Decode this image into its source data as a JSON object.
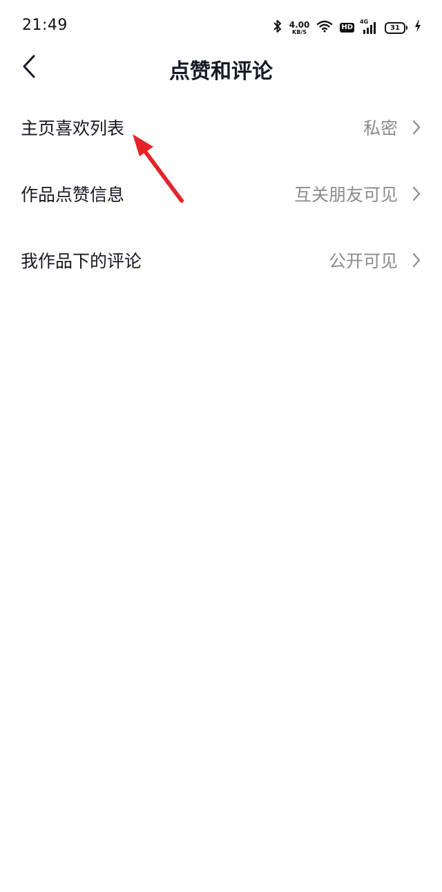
{
  "status_bar": {
    "time": "21:49",
    "net_speed_value": "4.00",
    "net_speed_unit": "KB/S",
    "hd_label": "HD",
    "signal_label": "4G",
    "battery_level": "31",
    "icons": [
      "bluetooth-icon",
      "wifi-icon",
      "hd-icon",
      "signal-icon",
      "battery-icon",
      "charging-icon"
    ]
  },
  "header": {
    "title": "点赞和评论",
    "back_icon": "chevron-left-icon"
  },
  "settings": {
    "items": [
      {
        "label": "主页喜欢列表",
        "value": "私密"
      },
      {
        "label": "作品点赞信息",
        "value": "互关朋友可见"
      },
      {
        "label": "我作品下的评论",
        "value": "公开可见"
      }
    ]
  },
  "annotation": {
    "type": "arrow",
    "color": "#e3242b",
    "points_to": "主页喜欢列表"
  }
}
